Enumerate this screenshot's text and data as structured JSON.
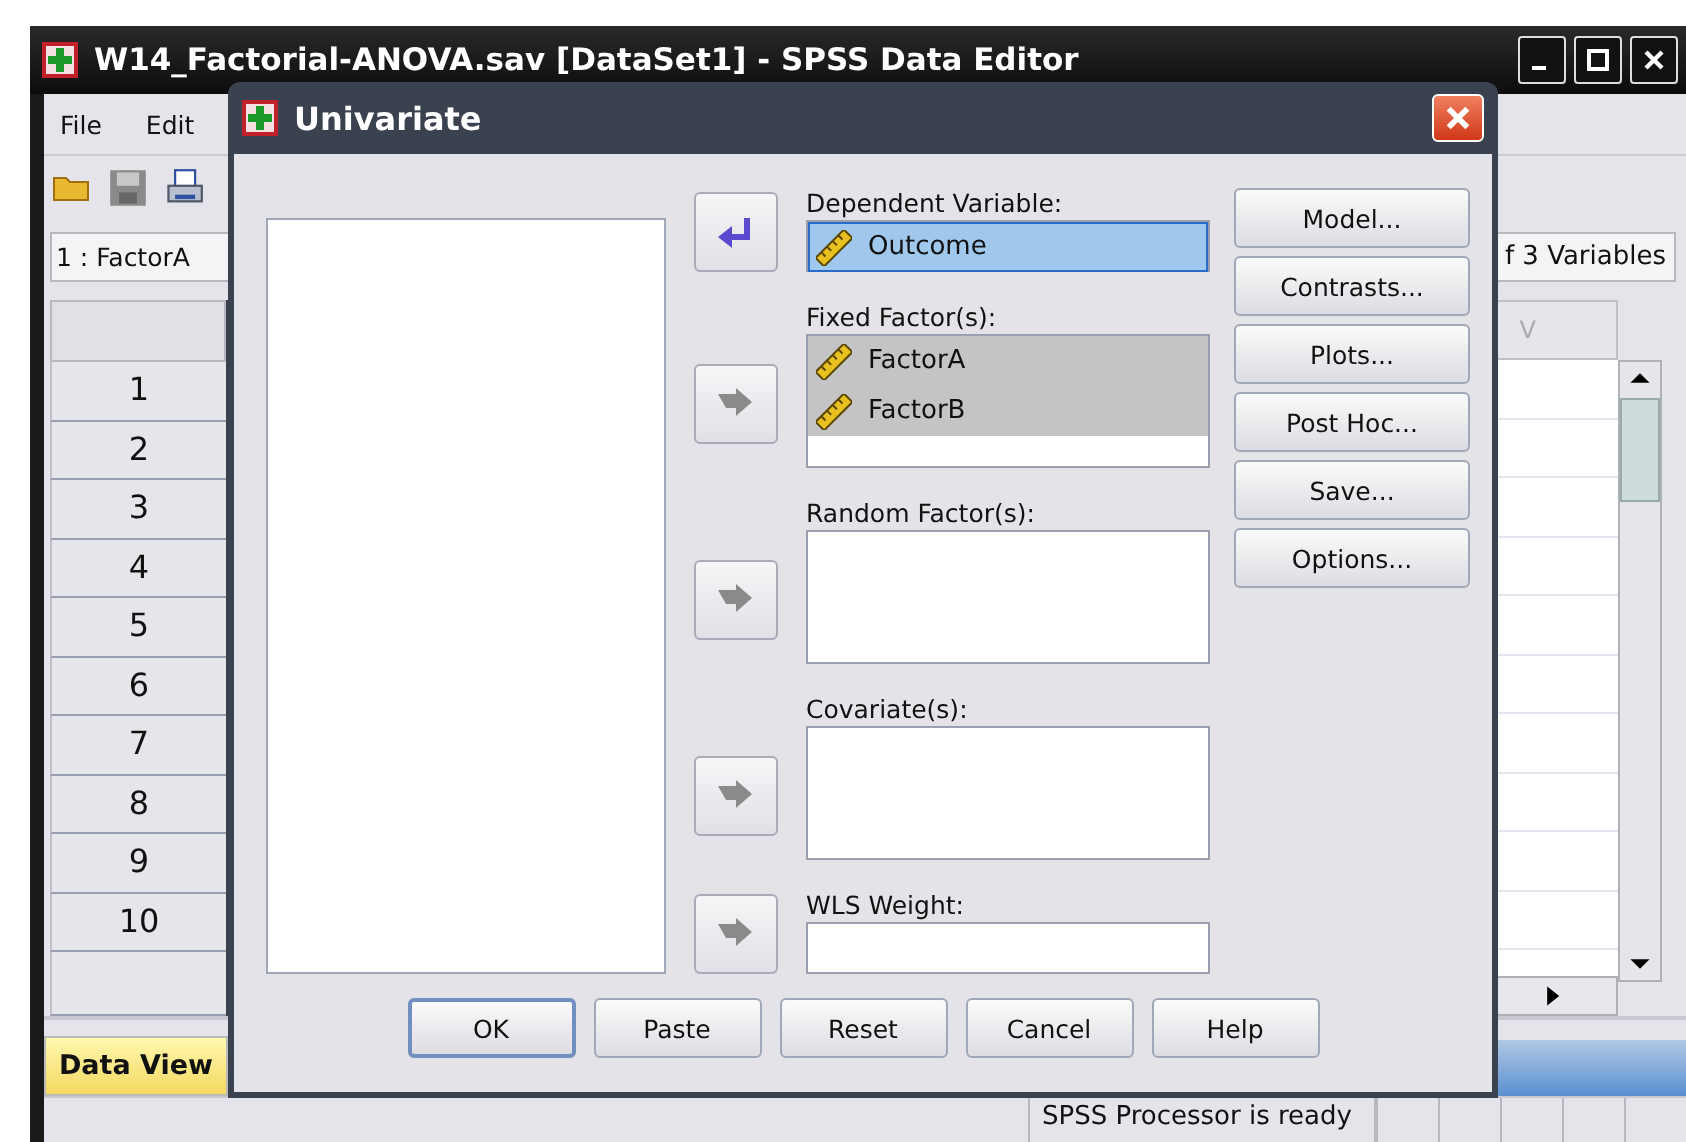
{
  "main_window": {
    "title": "W14_Factorial-ANOVA.sav [DataSet1] - SPSS Data Editor"
  },
  "menu": [
    "File",
    "Edit"
  ],
  "cell_reference": "1 : FactorA",
  "variable_count": "f 3 Variables",
  "grid": {
    "column_header": "V",
    "rows": [
      "1",
      "2",
      "3",
      "4",
      "5",
      "6",
      "7",
      "8",
      "9",
      "10"
    ]
  },
  "view_tabs": [
    {
      "label": "Data View",
      "selected": true
    }
  ],
  "status_bar": "SPSS  Processor is ready",
  "dialog": {
    "title": "Univariate",
    "targets": [
      {
        "label": "Dependent Variable:",
        "kind": "single",
        "arrow": {
          "kind": "remove",
          "disabled": false
        },
        "items": [
          {
            "name": "Outcome",
            "selected": true,
            "focused": true
          }
        ]
      },
      {
        "label": "Fixed Factor(s):",
        "kind": "multi",
        "arrow": {
          "kind": "add",
          "disabled": true
        },
        "items": [
          {
            "name": "FactorA",
            "selected": true,
            "focused": false
          },
          {
            "name": "FactorB",
            "selected": true,
            "focused": false
          }
        ]
      },
      {
        "label": "Random Factor(s):",
        "kind": "multi",
        "arrow": {
          "kind": "add",
          "disabled": true
        }
      },
      {
        "label": "Covariate(s):",
        "kind": "multi",
        "arrow": {
          "kind": "add",
          "disabled": true
        }
      },
      {
        "label": "WLS Weight:",
        "kind": "single",
        "arrow": {
          "kind": "add",
          "disabled": true
        }
      }
    ],
    "side_buttons": [
      "Model...",
      "Contrasts...",
      "Plots...",
      "Post Hoc...",
      "Save...",
      "Options..."
    ],
    "footer_buttons": [
      {
        "label": "OK",
        "default": true
      },
      {
        "label": "Paste",
        "default": false
      },
      {
        "label": "Reset",
        "default": false
      },
      {
        "label": "Cancel",
        "default": false
      },
      {
        "label": "Help",
        "default": false
      }
    ]
  }
}
